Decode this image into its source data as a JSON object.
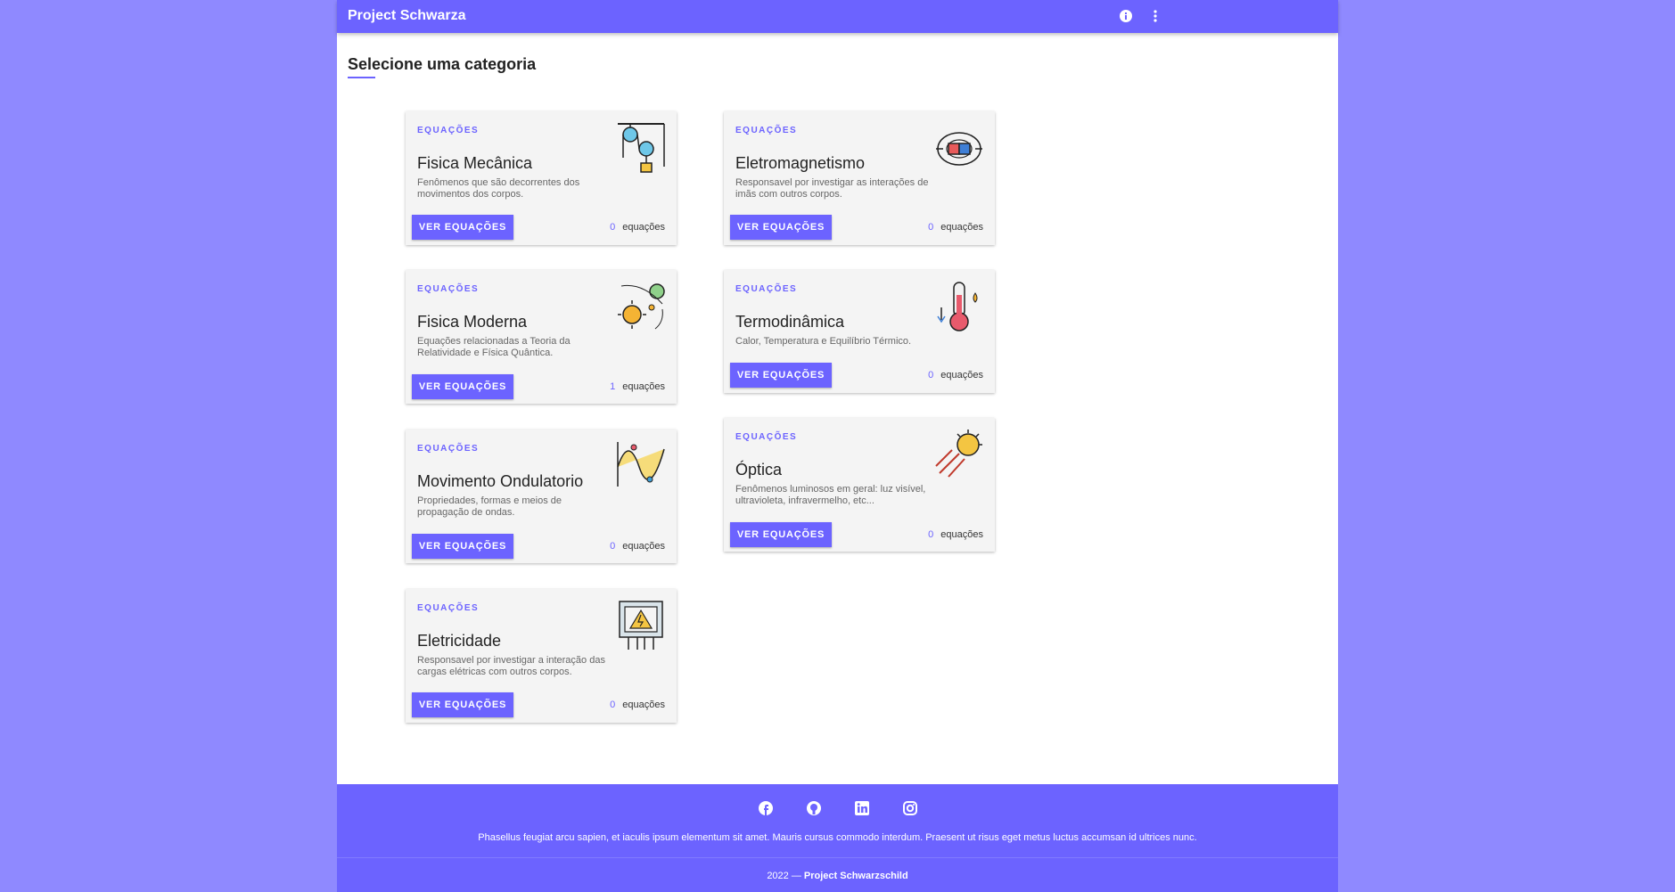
{
  "header": {
    "brand": "Project Schwarza",
    "icons": [
      "info-icon",
      "more-vert-icon"
    ]
  },
  "main": {
    "heading": "Selecione uma categoria",
    "cards": [
      {
        "eyebrow": "EQUAÇÕES",
        "title": "Fisica Mecânica",
        "desc": "Fenômenos que são decorrentes dos movimentos dos corpos.",
        "button": "VER EQUAÇÕES",
        "count": "0",
        "count_label": "equações",
        "icon": "pulley-icon"
      },
      {
        "eyebrow": "EQUAÇÕES",
        "title": "Eletromagnetismo",
        "desc": "Responsavel por investigar as interações de imãs com outros corpos.",
        "button": "VER EQUAÇÕES",
        "count": "0",
        "count_label": "equações",
        "icon": "magnet-icon"
      },
      {
        "eyebrow": "EQUAÇÕES",
        "title": "Fisica Moderna",
        "desc": "Equações relacionadas a Teoria da Relatividade e Física Quântica.",
        "button": "VER EQUAÇÕES",
        "count": "1",
        "count_label": "equações",
        "icon": "solar-system-icon"
      },
      {
        "eyebrow": "EQUAÇÕES",
        "title": "Termodinâmica",
        "desc": "Calor, Temperatura e Equilíbrio Térmico.",
        "button": "VER EQUAÇÕES",
        "count": "0",
        "count_label": "equações",
        "icon": "thermometer-icon"
      },
      {
        "eyebrow": "EQUAÇÕES",
        "title": "Movimento Ondulatorio",
        "desc": "Propriedades, formas e meios de propagação de ondas.",
        "button": "VER EQUAÇÕES",
        "count": "0",
        "count_label": "equações",
        "icon": "wave-icon"
      },
      {
        "eyebrow": "EQUAÇÕES",
        "title": "Óptica",
        "desc": "Fenômenos luminosos em geral: luz visível, ultravioleta, infravermelho, etc...",
        "button": "VER EQUAÇÕES",
        "count": "0",
        "count_label": "equações",
        "icon": "uv-sun-icon"
      },
      {
        "eyebrow": "EQUAÇÕES",
        "title": "Eletricidade",
        "desc": "Responsavel por investigar a interação das cargas elétricas com outros corpos.",
        "button": "VER EQUAÇÕES",
        "count": "0",
        "count_label": "equações",
        "icon": "electric-panel-icon"
      }
    ]
  },
  "footer": {
    "socials": [
      "facebook-icon",
      "github-icon",
      "linkedin-icon",
      "instagram-icon"
    ],
    "text": "Phasellus feugiat arcu sapien, et iaculis ipsum elementum sit amet. Mauris cursus commodo interdum. Praesent ut risus eget metus luctus accumsan id ultrices nunc.",
    "copy_prefix": "2022 —",
    "copy_brand": "Project Schwarzschild"
  },
  "colors": {
    "accent": "#6c63ff",
    "background": "#8f89ff",
    "card": "#f4f4f4"
  }
}
